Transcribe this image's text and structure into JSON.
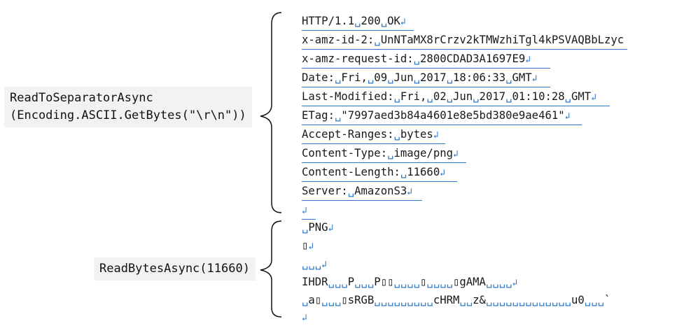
{
  "labels": {
    "separator": "ReadToSeparatorAsync\n(Encoding.ASCII.GetBytes(\"\\r\\n\"))",
    "bytes": "ReadBytesAsync(11660)"
  },
  "symbols": {
    "space": "␣",
    "crlf": "↲"
  },
  "header_lines": [
    "HTTP/1.1␣200␣OK↲",
    "x-amz-id-2:␣UnNTaMX8rCrzv2kTMWzhiTgl4kPSVAQBbLzyc",
    "x-amz-request-id:␣2800CDAD3A1697E9↲",
    "Date:␣Fri,␣09␣Jun␣2017␣18:06:33␣GMT↲",
    "Last-Modified:␣Fri,␣02␣Jun␣2017␣01:10:28␣GMT↲",
    "ETag:␣\"7997aed3b84a4601e8e5bd380e9ae461\"↲",
    "Accept-Ranges:␣bytes↲",
    "Content-Type:␣image/png↲",
    "Content-Length:␣11660↲",
    "Server:␣AmazonS3↲",
    "↲"
  ],
  "body_lines": [
    "␣PNG↲",
    "▯↲",
    "␣␣␣↲",
    "IHDR␣␣␣P␣␣␣P▯▯␣␣␣␣▯␣␣␣␣▯gAMA␣␣␣␣↲",
    "␣a▯␣␣␣▯sRGB␣␣␣␣␣␣␣␣␣cHRM␣␣z&␣␣␣␣␣␣␣␣␣␣␣␣␣u0␣␣␣`",
    "↲"
  ],
  "colors": {
    "marker": "#2f78c7",
    "label_bg": "#f2f2f2"
  }
}
